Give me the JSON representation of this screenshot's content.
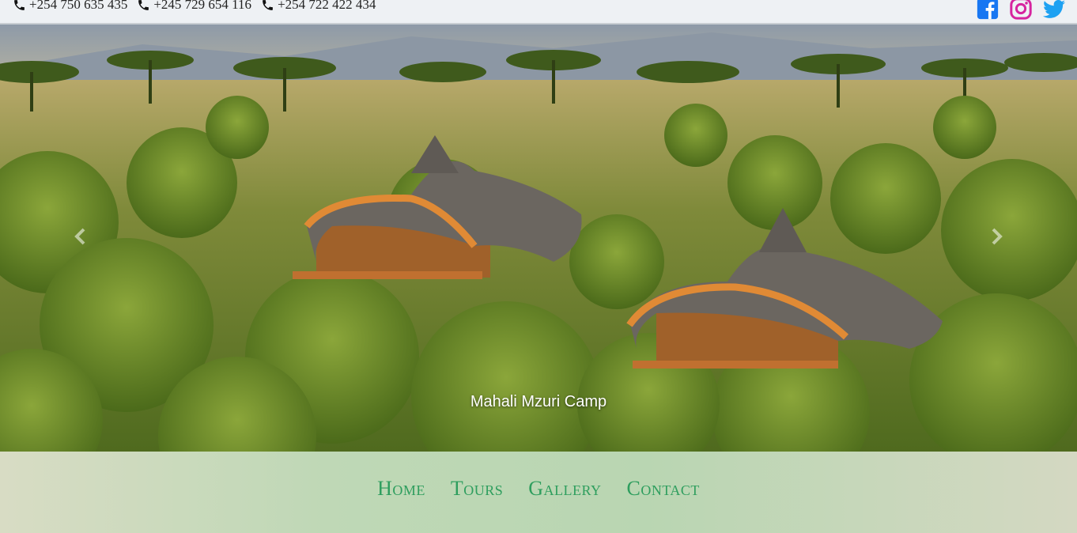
{
  "contact": {
    "phones": [
      "+254 750 635 435",
      "+245 729 654 116",
      "+254 722 422 434"
    ]
  },
  "social": {
    "items": [
      {
        "name": "facebook",
        "icon": "facebook-icon",
        "color": "#1877f2"
      },
      {
        "name": "instagram",
        "icon": "instagram-icon",
        "color": "#d6249f"
      },
      {
        "name": "twitter",
        "icon": "twitter-icon",
        "color": "#1da1f2"
      }
    ]
  },
  "carousel": {
    "caption": "Mahali Mzuri Camp",
    "prev_icon": "chevron-left-icon",
    "next_icon": "chevron-right-icon"
  },
  "nav": {
    "items": [
      "Home",
      "Tours",
      "Gallery",
      "Contact"
    ],
    "color": "#2e9e5e"
  }
}
